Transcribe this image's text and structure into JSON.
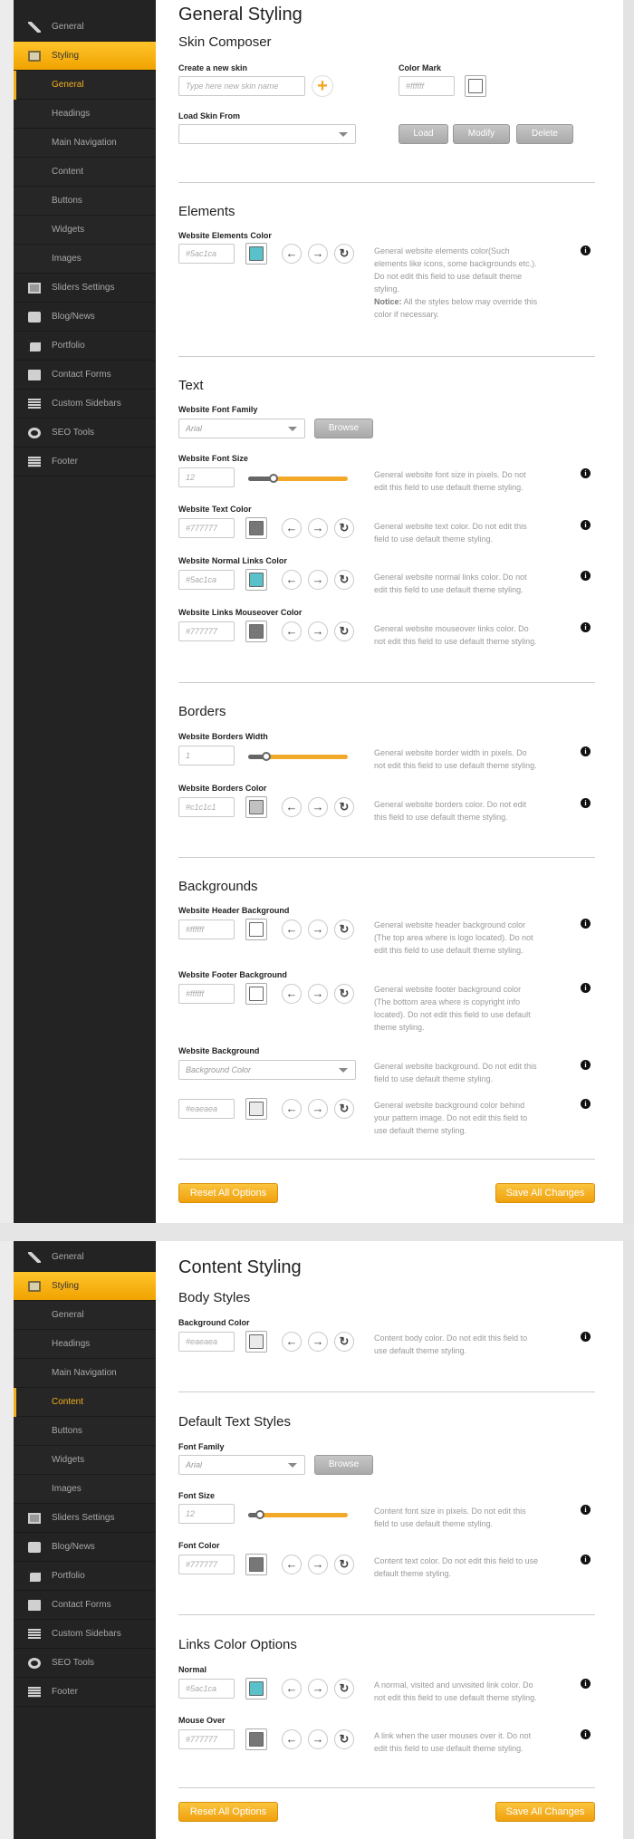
{
  "colors": {
    "accent": "#f2a51e",
    "sidebar": "#232323",
    "content_bg": "#ffffff"
  },
  "sidebar": {
    "items": [
      "General",
      "Styling",
      "Sliders Settings",
      "Blog/News",
      "Portfolio",
      "Contact Forms",
      "Custom Sidebars",
      "SEO Tools",
      "Footer"
    ],
    "sub": [
      "General",
      "Headings",
      "Main Navigation",
      "Content",
      "Buttons",
      "Widgets",
      "Images"
    ]
  },
  "panel1": {
    "title": "General Styling",
    "skin": {
      "heading": "Skin Composer",
      "create_label": "Create a new skin",
      "create_placeholder": "Type here new skin name",
      "color_mark_label": "Color Mark",
      "color_mark_value": "#ffffff",
      "load_label": "Load Skin From",
      "load": "Load",
      "modify": "Modify",
      "delete": "Delete"
    },
    "elements": {
      "heading": "Elements",
      "label": "Website Elements Color",
      "value": "#5ac1ca",
      "desc1": "General website elements color(Such elements like icons, some backgrounds etc.). Do not edit this field to use default theme styling.",
      "notice_label": "Notice:",
      "notice": "All the styles below may override this color if necessary."
    },
    "text": {
      "heading": "Text",
      "font_family_label": "Website Font Family",
      "font_family": "Arial",
      "browse": "Browse",
      "font_size_label": "Website Font Size",
      "font_size": "12",
      "font_size_desc": "General website font size in pixels. Do not edit this field to use default theme styling.",
      "font_size_level": 0.25,
      "text_color_label": "Website Text Color",
      "text_color": "#777777",
      "text_color_desc": "General website text color. Do not edit this field to use default theme styling.",
      "links_label": "Website Normal Links Color",
      "links": "#5ac1ca",
      "links_desc": "General website normal links color. Do not edit this field to use default theme styling.",
      "hover_label": "Website Links Mouseover Color",
      "hover": "#777777",
      "hover_desc": "General website mouseover links color. Do not edit this field to use default theme styling."
    },
    "borders": {
      "heading": "Borders",
      "width_label": "Website Borders Width",
      "width": "1",
      "width_level": 0.18,
      "width_desc": "General website border width in pixels. Do not edit this field to use default theme styling.",
      "color_label": "Website Borders Color",
      "color": "#c1c1c1",
      "color_desc": "General website borders color. Do not edit this field to use default theme styling."
    },
    "backgrounds": {
      "heading": "Backgrounds",
      "header_label": "Website Header Background",
      "header": "#ffffff",
      "header_desc": "General website header background color (The top area where is logo located). Do not edit this field to use default theme styling.",
      "footer_label": "Website Footer Background",
      "footer": "#ffffff",
      "footer_desc": "General website footer background color (The bottom area where is copyright info located). Do not edit this field to use default theme styling.",
      "bg_label": "Website Background",
      "bg_select": "Background Color",
      "bg_desc": "General website background. Do not edit this field to use default theme styling.",
      "pattern": "#eaeaea",
      "pattern_desc": "General website background color behind your pattern image. Do not edit this field to use default theme styling."
    },
    "reset": "Reset All Options",
    "save": "Save All Changes"
  },
  "panel2": {
    "title": "Content Styling",
    "body": {
      "heading": "Body Styles",
      "bg_label": "Background Color",
      "bg": "#eaeaea",
      "bg_desc": "Content body color. Do not edit this field to use default theme styling."
    },
    "text": {
      "heading": "Default Text Styles",
      "family_label": "Font Family",
      "family": "Arial",
      "browse": "Browse",
      "size_label": "Font Size",
      "size": "12",
      "size_level": 0.12,
      "size_desc": "Content font size in pixels. Do not edit this field to use default theme styling.",
      "color_label": "Font Color",
      "color": "#777777",
      "color_desc": "Content text color. Do not edit this field to use default theme styling."
    },
    "links": {
      "heading": "Links Color Options",
      "normal_label": "Normal",
      "normal": "#5ac1ca",
      "normal_desc": "A normal, visited and unvisited link color. Do not edit this field to use default theme styling.",
      "over_label": "Mouse Over",
      "over": "#777777",
      "over_desc": "A link when the user mouses over it. Do not edit this field to use default theme styling."
    },
    "reset": "Reset All Options",
    "save": "Save All Changes"
  }
}
